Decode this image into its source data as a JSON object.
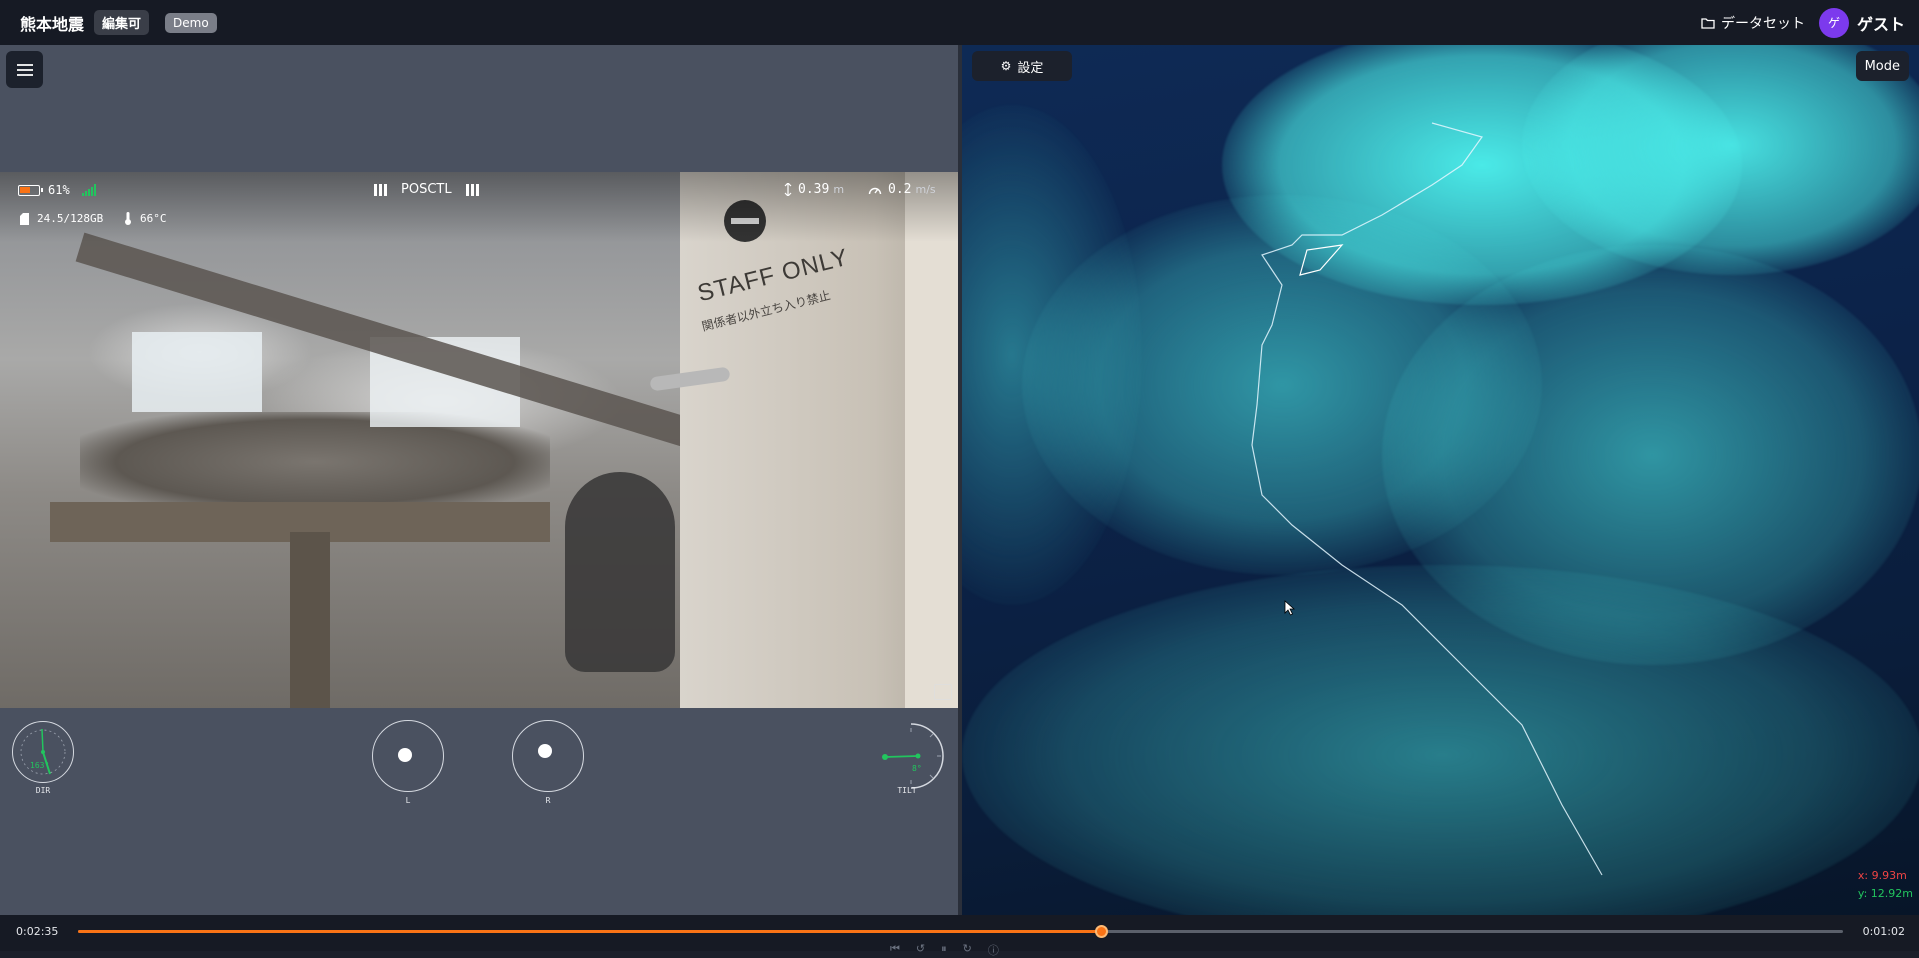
{
  "header": {
    "title": "熊本地震",
    "edit_badge": "編集可",
    "demo_badge": "Demo",
    "dataset_label": "データセット",
    "avatar_initial": "ゲ",
    "username": "ゲスト"
  },
  "video_hud": {
    "battery_percent": "61%",
    "battery_level": 0.61,
    "storage": "24.5/128GB",
    "temperature": "66°C",
    "flight_mode": "POSCTL",
    "altitude_value": "0.39",
    "altitude_unit": "m",
    "speed_value": "0.2",
    "speed_unit": "m/s",
    "sign_text": "STAFF ONLY",
    "sign_subtext": "関係者以外立ち入り禁止"
  },
  "gauges": {
    "direction_label": "DIR",
    "direction_value": "163°",
    "left_stick_label": "L",
    "right_stick_label": "R",
    "tilt_label": "TILT",
    "tilt_value": "8°"
  },
  "viewer": {
    "settings_label": "設定",
    "mode_label": "Mode",
    "x_coord": "x: 9.93m",
    "y_coord": "y: 12.92m"
  },
  "timeline": {
    "current_time": "0:02:35",
    "end_time": "0:01:02",
    "progress": 0.58
  },
  "colors": {
    "accent": "#f97316",
    "cloud": "#4ef5f0",
    "avatar": "#7c3aed"
  }
}
